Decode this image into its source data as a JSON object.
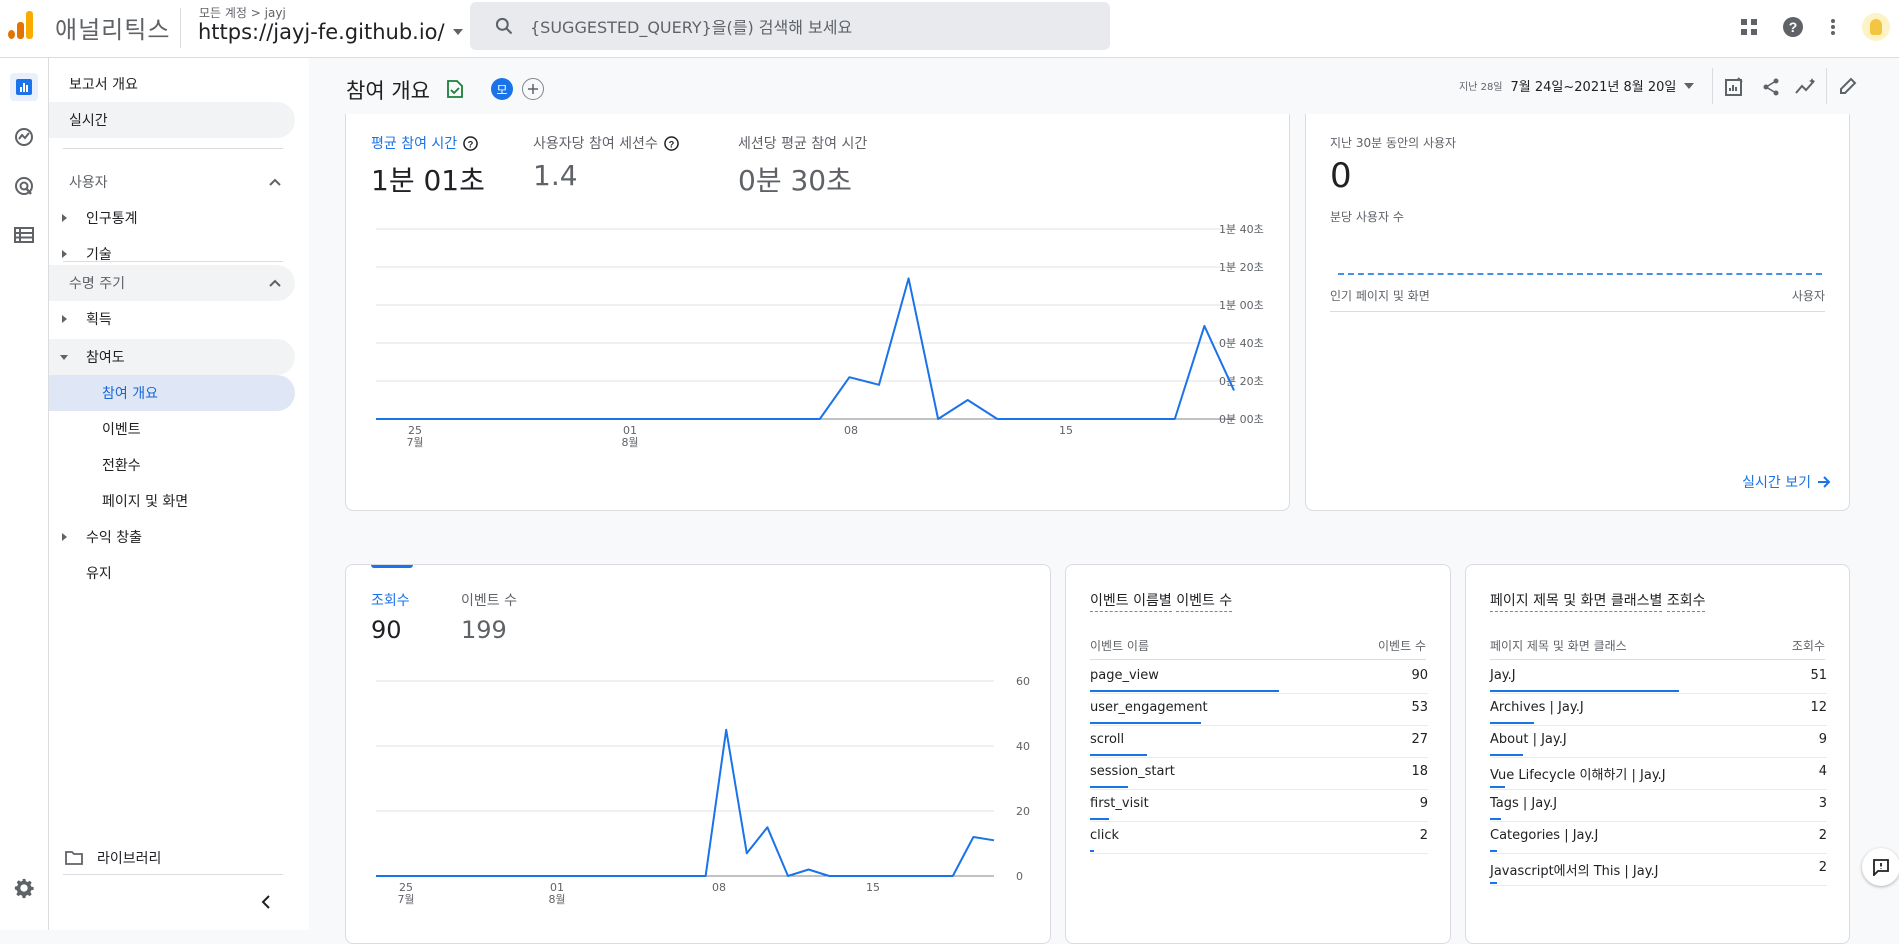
{
  "header": {
    "app_name": "애널리틱스",
    "breadcrumb": "모든 계정 > jayj",
    "property": "https://jayj-fe.github.io/",
    "search_placeholder": "{SUGGESTED_QUERY}을(를) 검색해 보세요"
  },
  "nav": {
    "overview": "보고서 개요",
    "realtime": "실시간",
    "users_section": "사용자",
    "demographics": "인구통계",
    "tech": "기술",
    "lifecycle_section": "수명 주기",
    "acquisition": "획득",
    "engagement": "참여도",
    "engagement_overview": "참여 개요",
    "events": "이벤트",
    "conversions": "전환수",
    "pages_screens": "페이지 및 화면",
    "monetization": "수익 창출",
    "retention": "유지",
    "library": "라이브러리"
  },
  "page": {
    "title": "참여 개요",
    "avatar_letter": "모",
    "date_prefix": "지난 28일",
    "date_range": "7월 24일~2021년 8월 20일"
  },
  "engagement_card": {
    "metrics": [
      {
        "label": "평균 참여 시간",
        "value": "1분 01초"
      },
      {
        "label": "사용자당 참여 세션수",
        "value": "1.4"
      },
      {
        "label": "세션당 평균 참여 시간",
        "value": "0분 30초"
      }
    ],
    "y_ticks": [
      "1분 40초",
      "1분 20초",
      "1분 00초",
      "0분 40초",
      "0분 20초",
      "0분 00초"
    ],
    "x_ticks": [
      {
        "day": "25",
        "month": "7월"
      },
      {
        "day": "01",
        "month": "8월"
      },
      {
        "day": "08",
        "month": ""
      },
      {
        "day": "15",
        "month": ""
      }
    ]
  },
  "realtime_card": {
    "label": "지난 30분 동안의 사용자",
    "value": "0",
    "per_minute": "분당 사용자 수",
    "col_left": "인기 페이지 및 화면",
    "col_right": "사용자",
    "link": "실시간 보기"
  },
  "views_card": {
    "metrics": [
      {
        "label": "조회수",
        "value": "90"
      },
      {
        "label": "이벤트 수",
        "value": "199"
      }
    ],
    "y_ticks": [
      "60",
      "40",
      "20",
      "0"
    ],
    "x_ticks": [
      {
        "day": "25",
        "month": "7월"
      },
      {
        "day": "01",
        "month": "8월"
      },
      {
        "day": "08",
        "month": ""
      },
      {
        "day": "15",
        "month": ""
      }
    ]
  },
  "events_card": {
    "title_a": "이벤트 이름별",
    "title_b": "이벤트 수",
    "col_name": "이벤트 이름",
    "col_value": "이벤트 수",
    "rows": [
      {
        "name": "page_view",
        "value": "90"
      },
      {
        "name": "user_engagement",
        "value": "53"
      },
      {
        "name": "scroll",
        "value": "27"
      },
      {
        "name": "session_start",
        "value": "18"
      },
      {
        "name": "first_visit",
        "value": "9"
      },
      {
        "name": "click",
        "value": "2"
      }
    ]
  },
  "pages_card": {
    "title_a": "페이지 제목 및 화면 클래스별",
    "title_b": "조회수",
    "col_name": "페이지 제목 및 화면 클래스",
    "col_value": "조회수",
    "rows": [
      {
        "name": "Jay.J",
        "value": "51"
      },
      {
        "name": "Archives | Jay.J",
        "value": "12"
      },
      {
        "name": "About | Jay.J",
        "value": "9"
      },
      {
        "name": "Vue Lifecycle 이해하기 | Jay.J",
        "value": "4"
      },
      {
        "name": "Tags | Jay.J",
        "value": "3"
      },
      {
        "name": "Categories | Jay.J",
        "value": "2"
      },
      {
        "name": "Javascript에서의 This | Jay.J",
        "value": "2"
      }
    ]
  },
  "chart_data": [
    {
      "type": "line",
      "series": [
        {
          "name": "평균 참여 시간",
          "values": [
            0,
            0,
            0,
            0,
            0,
            0,
            0,
            0,
            0,
            0,
            0,
            0,
            0,
            0,
            0,
            0,
            22,
            18,
            74,
            0,
            10,
            0,
            0,
            0,
            0,
            0,
            0,
            0,
            49,
            15
          ]
        }
      ],
      "yunit": "seconds",
      "ylim": [
        0,
        100
      ],
      "x_ticks": [
        "25 7월",
        "01 8월",
        "08",
        "15"
      ]
    },
    {
      "type": "line",
      "series": [
        {
          "name": "조회수",
          "values": [
            0,
            0,
            0,
            0,
            0,
            0,
            0,
            0,
            0,
            0,
            0,
            0,
            0,
            0,
            0,
            0,
            0,
            45,
            7,
            15,
            0,
            2,
            0,
            0,
            0,
            0,
            0,
            0,
            0,
            12,
            11
          ]
        }
      ],
      "ylim": [
        0,
        60
      ],
      "x_ticks": [
        "25 7월",
        "01 8월",
        "08",
        "15"
      ]
    }
  ],
  "colors": {
    "accent": "#1a73e8",
    "logo_orange": "#f9ab00",
    "logo_dark": "#e37400",
    "check": "#188038"
  }
}
